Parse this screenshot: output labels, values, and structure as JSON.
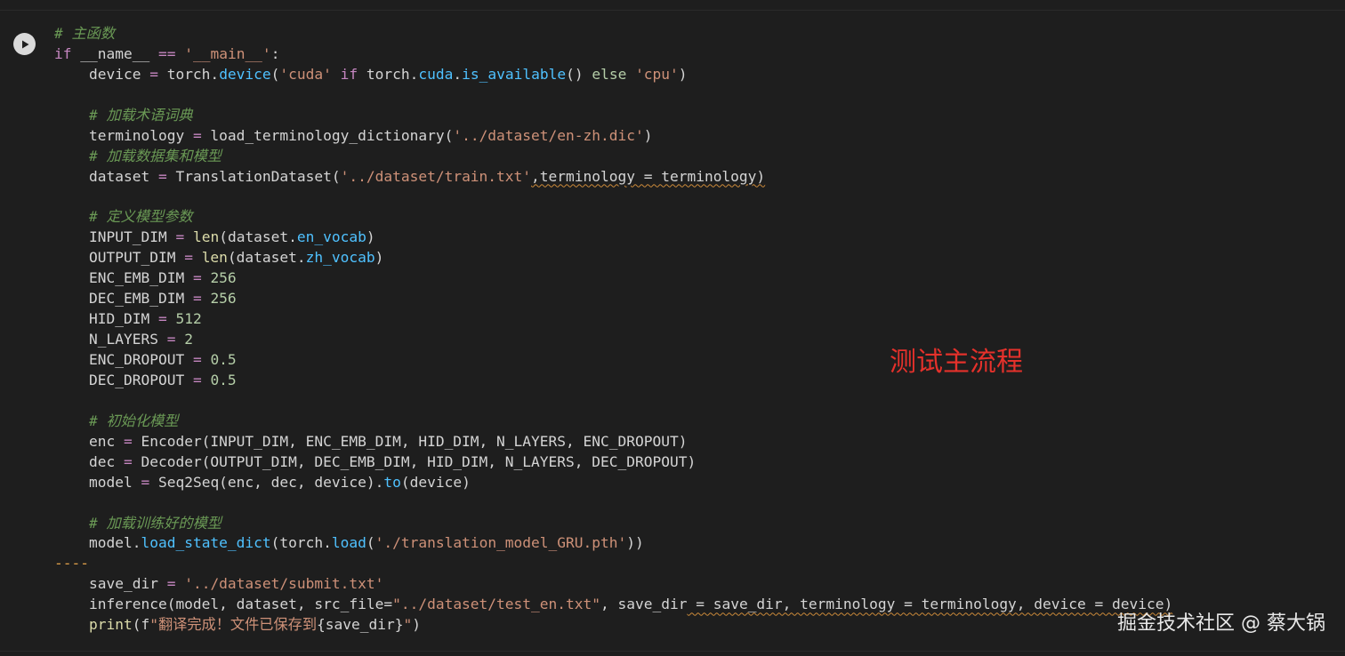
{
  "run_button": {
    "icon": "play-icon"
  },
  "code_lines": [
    [
      {
        "t": "# 主函数",
        "c": "cm"
      }
    ],
    [
      {
        "t": "if",
        "c": "kw"
      },
      {
        "t": " __name__ "
      },
      {
        "t": "==",
        "c": "op"
      },
      {
        "t": " "
      },
      {
        "t": "'__main__'",
        "c": "str"
      },
      {
        "t": ":"
      }
    ],
    [
      {
        "t": "    device "
      },
      {
        "t": "=",
        "c": "op"
      },
      {
        "t": " torch."
      },
      {
        "t": "device",
        "c": "fn"
      },
      {
        "t": "("
      },
      {
        "t": "'cuda'",
        "c": "str"
      },
      {
        "t": " "
      },
      {
        "t": "if",
        "c": "kw"
      },
      {
        "t": " torch."
      },
      {
        "t": "cuda",
        "c": "fn"
      },
      {
        "t": "."
      },
      {
        "t": "is_available",
        "c": "fn"
      },
      {
        "t": "() "
      },
      {
        "t": "else",
        "c": "kwelse"
      },
      {
        "t": " "
      },
      {
        "t": "'cpu'",
        "c": "str"
      },
      {
        "t": ")"
      }
    ],
    [],
    [
      {
        "t": "    "
      },
      {
        "t": "# 加载术语词典",
        "c": "cm"
      }
    ],
    [
      {
        "t": "    terminology "
      },
      {
        "t": "=",
        "c": "op"
      },
      {
        "t": " load_terminology_dictionary("
      },
      {
        "t": "'../dataset/en-zh.dic'",
        "c": "str"
      },
      {
        "t": ")"
      }
    ],
    [
      {
        "t": "    "
      },
      {
        "t": "# 加载数据集和模型",
        "c": "cm"
      }
    ],
    [
      {
        "t": "    dataset "
      },
      {
        "t": "=",
        "c": "op"
      },
      {
        "t": " TranslationDataset("
      },
      {
        "t": "'../dataset/train.txt'",
        "c": "str"
      },
      {
        "t": ",terminology = terminology)",
        "c": "dim",
        "w": true
      }
    ],
    [],
    [
      {
        "t": "    "
      },
      {
        "t": "# 定义模型参数",
        "c": "cm"
      }
    ],
    [
      {
        "t": "    INPUT_DIM "
      },
      {
        "t": "=",
        "c": "op"
      },
      {
        "t": " "
      },
      {
        "t": "len",
        "c": "bi"
      },
      {
        "t": "(dataset."
      },
      {
        "t": "en_vocab",
        "c": "fn"
      },
      {
        "t": ")"
      }
    ],
    [
      {
        "t": "    OUTPUT_DIM "
      },
      {
        "t": "=",
        "c": "op"
      },
      {
        "t": " "
      },
      {
        "t": "len",
        "c": "bi"
      },
      {
        "t": "(dataset."
      },
      {
        "t": "zh_vocab",
        "c": "fn"
      },
      {
        "t": ")"
      }
    ],
    [
      {
        "t": "    ENC_EMB_DIM "
      },
      {
        "t": "=",
        "c": "op"
      },
      {
        "t": " "
      },
      {
        "t": "256",
        "c": "num"
      }
    ],
    [
      {
        "t": "    DEC_EMB_DIM "
      },
      {
        "t": "=",
        "c": "op"
      },
      {
        "t": " "
      },
      {
        "t": "256",
        "c": "num"
      }
    ],
    [
      {
        "t": "    HID_DIM "
      },
      {
        "t": "=",
        "c": "op"
      },
      {
        "t": " "
      },
      {
        "t": "512",
        "c": "num"
      }
    ],
    [
      {
        "t": "    N_LAYERS "
      },
      {
        "t": "=",
        "c": "op"
      },
      {
        "t": " "
      },
      {
        "t": "2",
        "c": "num"
      }
    ],
    [
      {
        "t": "    ENC_DROPOUT "
      },
      {
        "t": "=",
        "c": "op"
      },
      {
        "t": " "
      },
      {
        "t": "0.5",
        "c": "num"
      }
    ],
    [
      {
        "t": "    DEC_DROPOUT "
      },
      {
        "t": "=",
        "c": "op"
      },
      {
        "t": " "
      },
      {
        "t": "0.5",
        "c": "num"
      }
    ],
    [],
    [
      {
        "t": "    "
      },
      {
        "t": "# 初始化模型",
        "c": "cm"
      }
    ],
    [
      {
        "t": "    enc "
      },
      {
        "t": "=",
        "c": "op"
      },
      {
        "t": " Encoder(INPUT_DIM, ENC_EMB_DIM, HID_DIM, N_LAYERS, ENC_DROPOUT)"
      }
    ],
    [
      {
        "t": "    dec "
      },
      {
        "t": "=",
        "c": "op"
      },
      {
        "t": " Decoder(OUTPUT_DIM, DEC_EMB_DIM, HID_DIM, N_LAYERS, DEC_DROPOUT)"
      }
    ],
    [
      {
        "t": "    model "
      },
      {
        "t": "=",
        "c": "op"
      },
      {
        "t": " Seq2Seq(enc, dec, device)."
      },
      {
        "t": "to",
        "c": "fn"
      },
      {
        "t": "(device)"
      }
    ],
    [],
    [
      {
        "t": "    "
      },
      {
        "t": "# 加载训练好的模型",
        "c": "cm"
      }
    ],
    [
      {
        "t": "    model."
      },
      {
        "t": "load_state_dict",
        "c": "fn"
      },
      {
        "t": "(torch."
      },
      {
        "t": "load",
        "c": "fn"
      },
      {
        "t": "("
      },
      {
        "t": "'./translation_model_GRU.pth'",
        "c": "str"
      },
      {
        "t": "))"
      }
    ],
    [
      {
        "t": "----",
        "c": "dashes"
      }
    ],
    [
      {
        "t": "    save_dir "
      },
      {
        "t": "=",
        "c": "op"
      },
      {
        "t": " "
      },
      {
        "t": "'../dataset/submit.txt'",
        "c": "str"
      }
    ],
    [
      {
        "t": "    inference(model, dataset, src_file="
      },
      {
        "t": "\"../dataset/test_en.txt\"",
        "c": "str"
      },
      {
        "t": ", save_dir"
      },
      {
        "t": " = save_dir, terminology = terminology, device = device)",
        "w": true
      }
    ],
    [
      {
        "t": "    "
      },
      {
        "t": "print",
        "c": "bi"
      },
      {
        "t": "(f"
      },
      {
        "t": "\"翻译完成！文件已保存到",
        "c": "str"
      },
      {
        "t": "{save_dir}"
      },
      {
        "t": "\"",
        "c": "str"
      },
      {
        "t": ")"
      }
    ]
  ],
  "annotation": "测试主流程",
  "watermark": "掘金技术社区 @ 蔡大锅"
}
